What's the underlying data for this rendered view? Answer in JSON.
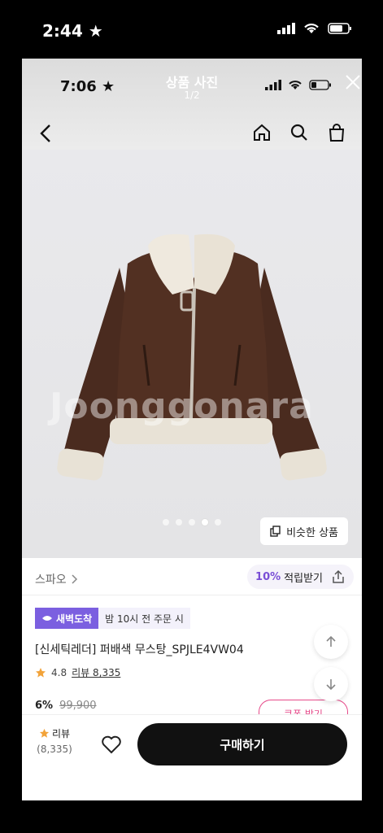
{
  "outer_status": {
    "time": "2:44"
  },
  "inner_status": {
    "time": "7:06"
  },
  "viewer": {
    "title": "상품 사진",
    "counter": "1/2"
  },
  "photo": {
    "watermark": "Joonggonara",
    "dots_total": 5,
    "dots_active_index": 3,
    "similar_button": "비슷한 상품"
  },
  "brand": {
    "name": "스파오",
    "points_percent": "10%",
    "points_label": "적립받기"
  },
  "badges": {
    "delivery": "새벽도착",
    "cutoff": "밤 10시 전 주문 시"
  },
  "product": {
    "name": "[신세틱레더] 퍼배색 무스탕_SPJLE4VW04",
    "rating": "4.8",
    "review_link": "리뷰 8,335",
    "discount": "6%",
    "original_price": "99,900"
  },
  "coupon_peek": "쿠폰 받기",
  "bottom_bar": {
    "review_label": "리뷰",
    "review_count": "(8,335)",
    "buy_button": "구매하기"
  },
  "colors": {
    "accent_purple": "#7b5fe0",
    "star": "#f2a33a",
    "buy_button_bg": "#111111",
    "coupon_pink": "#e64a8a"
  }
}
